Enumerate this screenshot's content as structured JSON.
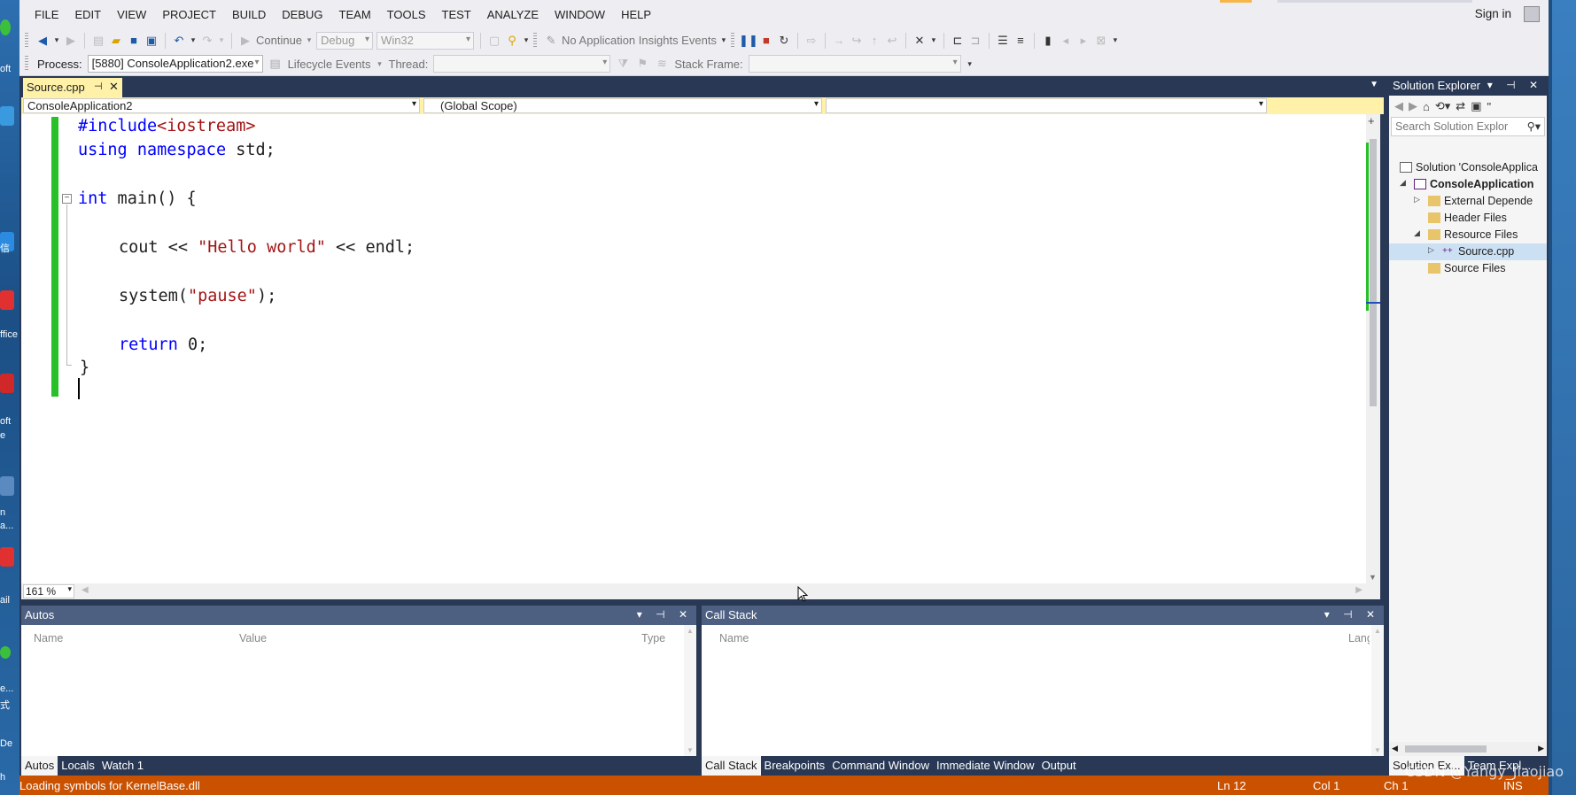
{
  "menu": [
    "FILE",
    "EDIT",
    "VIEW",
    "PROJECT",
    "BUILD",
    "DEBUG",
    "TEAM",
    "TOOLS",
    "TEST",
    "ANALYZE",
    "WINDOW",
    "HELP"
  ],
  "account": {
    "signin": "Sign in"
  },
  "toolbar": {
    "continue_label": "Continue",
    "config": "Debug",
    "platform": "Win32",
    "insights": "No Application Insights Events"
  },
  "debug_toolbar": {
    "process_label": "Process:",
    "process_value": "[5880] ConsoleApplication2.exe",
    "lifecycle_label": "Lifecycle Events",
    "thread_label": "Thread:",
    "stackframe_label": "Stack Frame:"
  },
  "editor": {
    "tab_title": "Source.cpp",
    "nav_project": "ConsoleApplication2",
    "nav_scope": "(Global Scope)",
    "zoom": "161 %"
  },
  "solution_explorer": {
    "title": "Solution Explorer",
    "search_placeholder": "Search Solution Explor",
    "tree": [
      {
        "label": "Solution 'ConsoleApplica",
        "indent": 0
      },
      {
        "label": "ConsoleApplication",
        "indent": 1,
        "bold": true
      },
      {
        "label": "External Depende",
        "indent": 2
      },
      {
        "label": "Header Files",
        "indent": 2
      },
      {
        "label": "Resource Files",
        "indent": 2
      },
      {
        "label": "Source.cpp",
        "indent": 3,
        "selected": true
      },
      {
        "label": "Source Files",
        "indent": 2
      }
    ],
    "bottom_tabs": [
      "Solution Ex...",
      "Team Expl..."
    ]
  },
  "autos": {
    "title": "Autos",
    "columns": [
      "Name",
      "Value",
      "Type"
    ],
    "tabs": [
      "Autos",
      "Locals",
      "Watch 1"
    ]
  },
  "callstack": {
    "title": "Call Stack",
    "columns": [
      "Name",
      "Lang"
    ],
    "tabs": [
      "Call Stack",
      "Breakpoints",
      "Command Window",
      "Immediate Window",
      "Output"
    ]
  },
  "statusbar": {
    "message": "Loading symbols for KernelBase.dll",
    "ln": "Ln 12",
    "col": "Col 1",
    "ch": "Ch 1",
    "ins": "INS"
  },
  "watermark": "CSDN @Yangy_Jiaojiao",
  "desktop_labels": [
    "oft",
    "信",
    "ffice",
    "oft",
    "e",
    "n",
    "a...",
    "ail",
    "e...",
    "式",
    "De",
    "h"
  ],
  "code": {
    "l1_directive": "#include",
    "l1_header": "<iostream>",
    "l2_using": "using",
    "l2_namespace": "namespace",
    "l2_rest": " std;",
    "l3_int": "int",
    "l3_rest": " main() {",
    "l4_cout": "cout << ",
    "l4_str": "\"Hello world\"",
    "l4_rest": " << endl;",
    "l5_system": "system(",
    "l5_str": "\"pause\"",
    "l5_rest": ");",
    "l6_return": "return",
    "l6_rest": " 0;",
    "l7_brace": "}"
  },
  "colors": {
    "status_bar": "#ca5100",
    "tab_active": "#fff1a8",
    "keyword": "#0000ff",
    "string": "#a31515",
    "change_bar": "#28c028"
  }
}
